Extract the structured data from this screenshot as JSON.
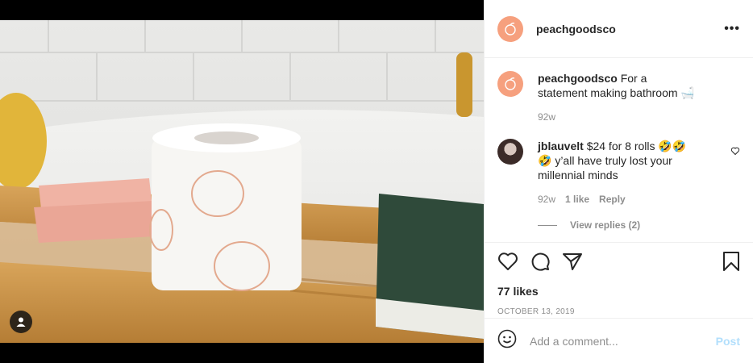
{
  "header": {
    "username": "peachgoodsco",
    "more_label": "•••"
  },
  "caption": {
    "username": "peachgoodsco",
    "text": "For a statement making bathroom 🛁",
    "age": "92w"
  },
  "comment": {
    "username": "jblauvelt",
    "text": "$24 for 8 rolls 🤣🤣 🤣 y’all have truly lost your millennial minds",
    "age": "92w",
    "likes": "1 like",
    "reply_label": "Reply",
    "view_replies": "View replies (2)"
  },
  "likes": "77 likes",
  "date": "OCTOBER 13, 2019",
  "add_comment": {
    "placeholder": "Add a comment...",
    "post_label": "Post"
  },
  "colors": {
    "peach": "#f6a07e",
    "accent_blue": "#b2dffc",
    "text": "#262626",
    "muted": "#8e8e8e"
  }
}
